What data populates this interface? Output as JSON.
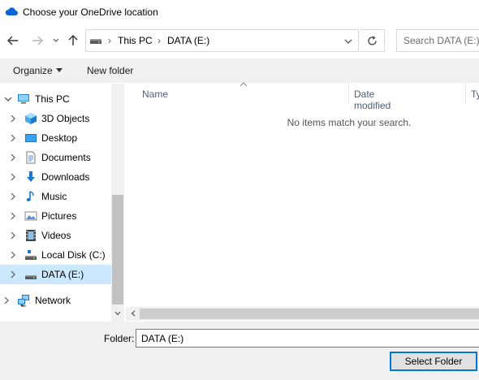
{
  "window": {
    "title": "Choose your OneDrive location",
    "icon": "onedrive-cloud-icon"
  },
  "navigation": {
    "address": {
      "segments": [
        "This PC",
        "DATA (E:)"
      ],
      "icon": "drive-icon"
    },
    "search_placeholder": "Search DATA (E:)"
  },
  "toolbar": {
    "organize_label": "Organize",
    "new_folder_label": "New folder"
  },
  "tree": {
    "items": [
      {
        "label": "This PC",
        "icon": "computer-icon"
      },
      {
        "label": "3D Objects",
        "icon": "3d-objects-icon"
      },
      {
        "label": "Desktop",
        "icon": "desktop-icon"
      },
      {
        "label": "Documents",
        "icon": "documents-icon"
      },
      {
        "label": "Downloads",
        "icon": "downloads-icon"
      },
      {
        "label": "Music",
        "icon": "music-icon"
      },
      {
        "label": "Pictures",
        "icon": "pictures-icon"
      },
      {
        "label": "Videos",
        "icon": "videos-icon"
      },
      {
        "label": "Local Disk (C:)",
        "icon": "local-disk-icon"
      },
      {
        "label": "DATA (E:)",
        "icon": "drive-icon",
        "selected": true
      },
      {
        "label": "Network",
        "icon": "network-icon"
      }
    ]
  },
  "file_list": {
    "columns": [
      "Name",
      "Date modified",
      "Ty"
    ],
    "empty_message": "No items match your search."
  },
  "footer": {
    "folder_label": "Folder:",
    "folder_value": "DATA (E:)",
    "select_button_label": "Select Folder"
  },
  "colors": {
    "selection": "#cce8ff",
    "accent": "#0078d7",
    "chrome": "#f0f0f0",
    "column_header_text": "#4c607a"
  }
}
